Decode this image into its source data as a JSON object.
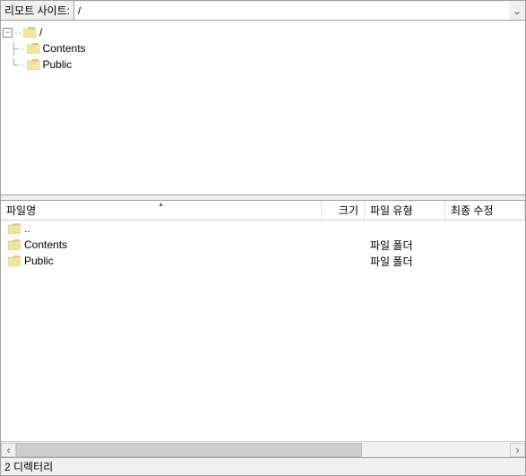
{
  "path_bar": {
    "label": "리모트 사이트:",
    "value": "/"
  },
  "tree": {
    "root_label": "/",
    "children": [
      {
        "label": "Contents"
      },
      {
        "label": "Public"
      }
    ]
  },
  "list": {
    "columns": {
      "name": "파일명",
      "size": "크기",
      "type": "파일 유형",
      "modified": "최종 수정"
    },
    "rows": [
      {
        "name": "..",
        "size": "",
        "type": "",
        "modified": ""
      },
      {
        "name": "Contents",
        "size": "",
        "type": "파일 폴더",
        "modified": ""
      },
      {
        "name": "Public",
        "size": "",
        "type": "파일 폴더",
        "modified": ""
      }
    ]
  },
  "status": "2 디렉터리"
}
